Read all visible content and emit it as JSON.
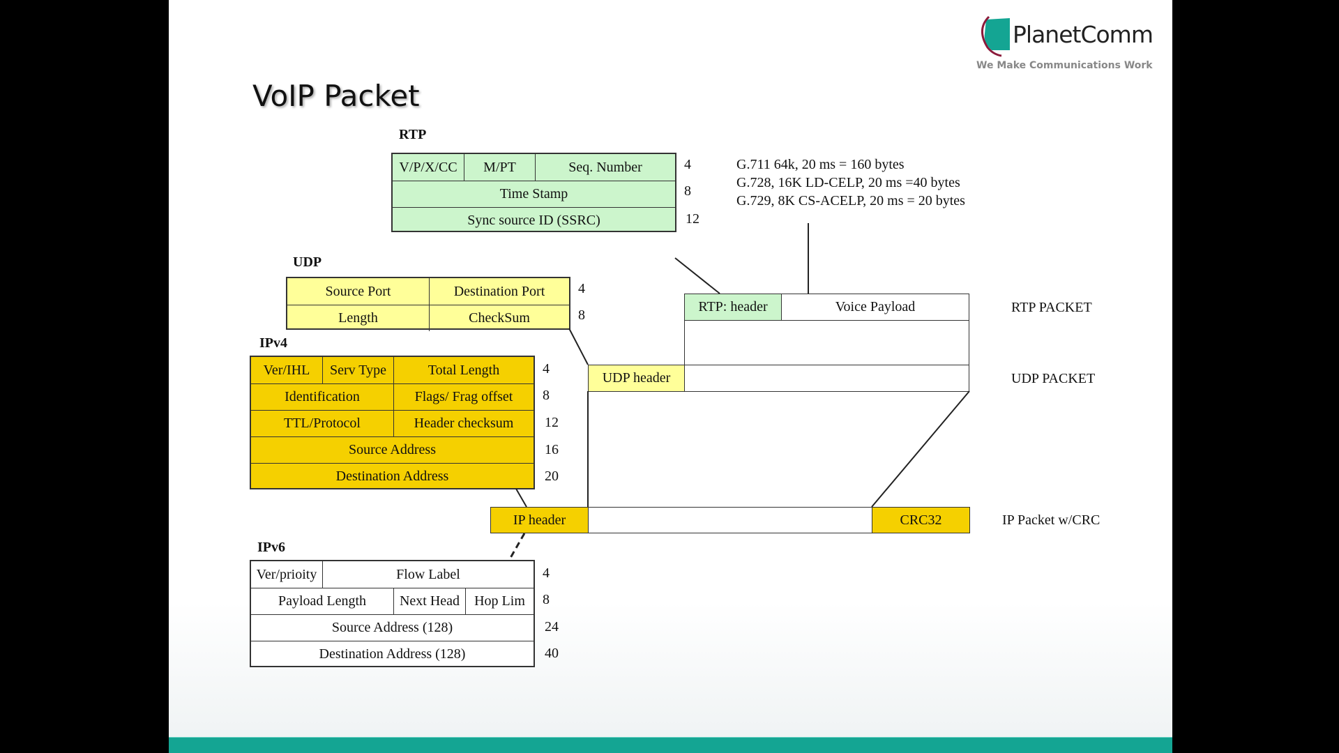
{
  "slide": {
    "title": "VoIP Packet",
    "logo": {
      "name": "PlanetComm",
      "tagline": "We Make Communications Work",
      "brand_color": "#14a593",
      "accent_color": "#8b1a3a"
    },
    "footer_bar_color": "#14a593"
  },
  "rtp": {
    "label": "RTP",
    "rows": [
      {
        "cells": [
          "V/P/X/CC",
          "M/PT",
          "Seq. Number"
        ],
        "offset": "4"
      },
      {
        "cells": [
          "Time Stamp"
        ],
        "offset": "8"
      },
      {
        "cells": [
          "Sync source ID (SSRC)"
        ],
        "offset": "12"
      }
    ],
    "color": "#ccf5cc"
  },
  "codecs": [
    "G.711 64k,  20 ms = 160 bytes",
    "G.728, 16K LD-CELP,  20 ms =40 bytes",
    "G.729,  8K  CS-ACELP,   20 ms =  20 bytes"
  ],
  "udp": {
    "label": "UDP",
    "rows": [
      {
        "cells": [
          "Source Port",
          "Destination Port"
        ],
        "offset": "4"
      },
      {
        "cells": [
          "Length",
          "CheckSum"
        ],
        "offset": "8"
      }
    ],
    "color": "#ffff99"
  },
  "ipv4": {
    "label": "IPv4",
    "rows": [
      {
        "cells": [
          "Ver/IHL",
          "Serv Type",
          "Total Length"
        ],
        "offset": "4"
      },
      {
        "cells": [
          "Identification",
          "Flags/ Frag offset"
        ],
        "offset": "8"
      },
      {
        "cells": [
          "TTL/Protocol",
          "Header checksum"
        ],
        "offset": "12"
      },
      {
        "cells": [
          "Source Address"
        ],
        "offset": "16"
      },
      {
        "cells": [
          "Destination Address"
        ],
        "offset": "20"
      }
    ],
    "color": "#f5d000"
  },
  "ipv6": {
    "label": "IPv6",
    "rows": [
      {
        "cells": [
          "Ver/prioity",
          "Flow Label"
        ],
        "offset": "4"
      },
      {
        "cells": [
          "Payload Length",
          "Next Head",
          "Hop Lim"
        ],
        "offset": "8"
      },
      {
        "cells": [
          "Source Address (128)"
        ],
        "offset": "24"
      },
      {
        "cells": [
          "Destination Address (128)"
        ],
        "offset": "40"
      }
    ],
    "color": "#ffffff"
  },
  "encapsulation": {
    "rtp_packet": {
      "header": "RTP: header",
      "payload": "Voice Payload",
      "label": "RTP PACKET"
    },
    "udp_packet": {
      "header": "UDP header",
      "label": "UDP PACKET"
    },
    "ip_packet": {
      "header": "IP header",
      "trailer": "CRC32",
      "label": "IP Packet  w/CRC"
    }
  }
}
